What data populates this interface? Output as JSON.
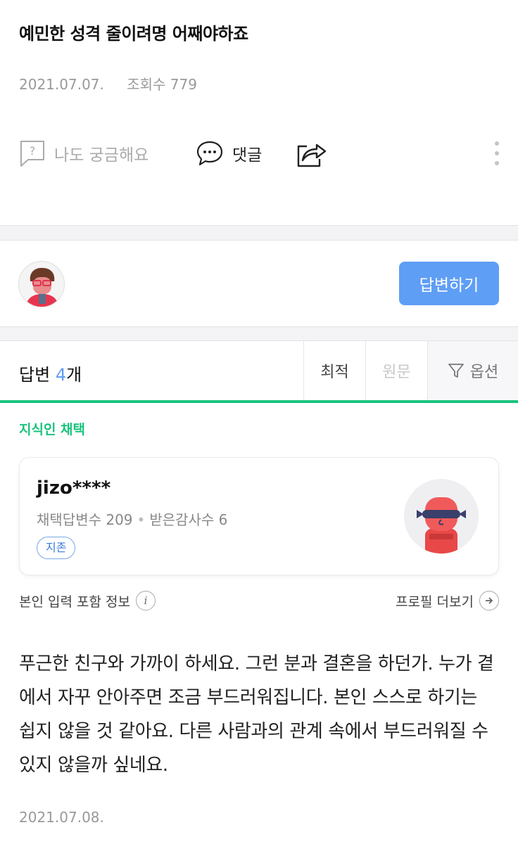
{
  "question": {
    "title": "예민한 성격 줄이려명 어째야하죠",
    "date": "2021.07.07.",
    "views": "조회수 779"
  },
  "actions": {
    "curious_label": "나도 궁금해요",
    "comment_label": "댓글"
  },
  "answer_prompt": {
    "button_label": "답변하기"
  },
  "answers_header": {
    "label": "답변",
    "count": "4",
    "unit": "개",
    "sort_latest": "최적",
    "sort_original": "원문",
    "sort_option": "옵션"
  },
  "adopted": {
    "label": "지식인 채택",
    "user": {
      "name": "jizo****",
      "adopted_answers": "채택답변수 209",
      "thanks_received": "받은감사수 6",
      "badge": "지존"
    }
  },
  "info_row": {
    "left": "본인 입력 포함 정보",
    "right": "프로필 더보기"
  },
  "answer": {
    "body": "푸근한 친구와 가까이 하세요. 그런 분과 결혼을 하던가. 누가 곁에서 자꾸 안아주면 조금 부드러워집니다. 본인 스스로 하기는 쉽지 않을 것 같아요. 다른 사람과의 관계 속에서 부드러워질 수 있지 않을까 싶네요.",
    "date": "2021.07.08."
  },
  "colors": {
    "accent_green": "#19c37d",
    "accent_blue": "#5f9ef5"
  }
}
